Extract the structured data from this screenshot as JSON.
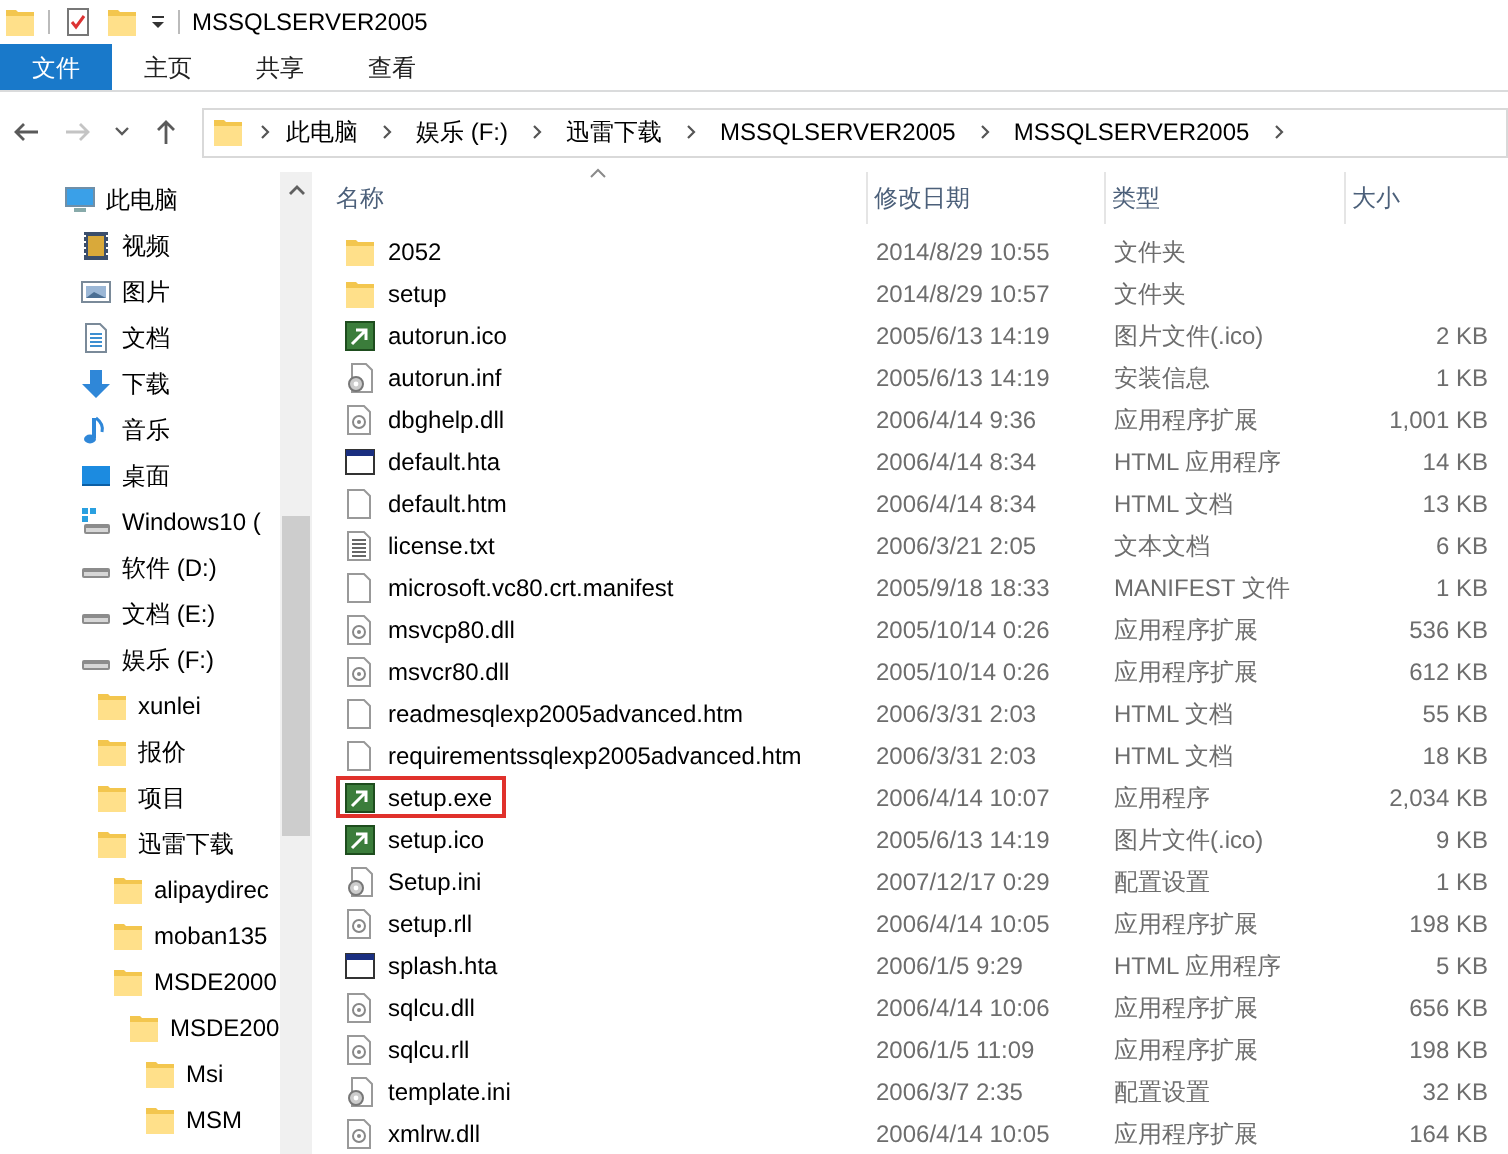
{
  "window": {
    "title": "MSSQLSERVER2005"
  },
  "ribbon_tabs": [
    {
      "label": "文件",
      "selected": true
    },
    {
      "label": "主页",
      "selected": false
    },
    {
      "label": "共享",
      "selected": false
    },
    {
      "label": "查看",
      "selected": false
    }
  ],
  "nav_buttons": [
    {
      "kind": "back",
      "disabled": false
    },
    {
      "kind": "forward",
      "disabled": true
    },
    {
      "kind": "recent",
      "disabled": false
    },
    {
      "kind": "up",
      "disabled": false
    }
  ],
  "breadcrumb": [
    "此电脑",
    "娱乐 (F:)",
    "迅雷下载",
    "MSSQLSERVER2005",
    "MSSQLSERVER2005"
  ],
  "sidebar": {
    "items": [
      {
        "label": "此电脑",
        "kind": "pc",
        "children": [
          {
            "label": "视频",
            "kind": "video"
          },
          {
            "label": "图片",
            "kind": "pictures"
          },
          {
            "label": "文档",
            "kind": "documents"
          },
          {
            "label": "下载",
            "kind": "downloads"
          },
          {
            "label": "音乐",
            "kind": "music"
          },
          {
            "label": "桌面",
            "kind": "desktop"
          },
          {
            "label": "Windows10 (",
            "kind": "os-drive"
          },
          {
            "label": "软件 (D:)",
            "kind": "drive"
          },
          {
            "label": "文档 (E:)",
            "kind": "drive"
          },
          {
            "label": "娱乐 (F:)",
            "kind": "drive",
            "children": [
              {
                "label": "xunlei",
                "kind": "folder"
              },
              {
                "label": "报价",
                "kind": "folder"
              },
              {
                "label": "项目",
                "kind": "folder"
              },
              {
                "label": "迅雷下载",
                "kind": "folder",
                "children": [
                  {
                    "label": "alipaydirec",
                    "kind": "folder"
                  },
                  {
                    "label": "moban135",
                    "kind": "folder"
                  },
                  {
                    "label": "MSDE2000",
                    "kind": "folder",
                    "children": [
                      {
                        "label": "MSDE200",
                        "kind": "folder",
                        "children": [
                          {
                            "label": "Msi",
                            "kind": "folder"
                          },
                          {
                            "label": "MSM",
                            "kind": "folder"
                          }
                        ]
                      }
                    ]
                  }
                ]
              }
            ]
          }
        ]
      }
    ]
  },
  "columns": [
    {
      "label": "名称",
      "sorted": true
    },
    {
      "label": "修改日期",
      "sorted": false
    },
    {
      "label": "类型",
      "sorted": false
    },
    {
      "label": "大小",
      "sorted": false
    }
  ],
  "files": [
    {
      "name": "2052",
      "date": "2014/8/29 10:55",
      "type": "文件夹",
      "kind": "folder",
      "marked": false
    },
    {
      "name": "setup",
      "date": "2014/8/29 10:57",
      "type": "文件夹",
      "kind": "folder",
      "marked": false
    },
    {
      "name": "autorun.ico",
      "date": "2005/6/13 14:19",
      "type": "图片文件(.ico)",
      "size": "2 KB",
      "kind": "image",
      "marked": false
    },
    {
      "name": "autorun.inf",
      "date": "2005/6/13 14:19",
      "type": "安装信息",
      "size": "1 KB",
      "kind": "config",
      "marked": false
    },
    {
      "name": "dbghelp.dll",
      "date": "2006/4/14 9:36",
      "type": "应用程序扩展",
      "size": "1,001 KB",
      "kind": "library",
      "marked": false
    },
    {
      "name": "default.hta",
      "date": "2006/4/14 8:34",
      "type": "HTML 应用程序",
      "size": "14 KB",
      "kind": "window",
      "marked": false
    },
    {
      "name": "default.htm",
      "date": "2006/4/14 8:34",
      "type": "HTML 文档",
      "size": "13 KB",
      "kind": "blank",
      "marked": false
    },
    {
      "name": "license.txt",
      "date": "2006/3/21 2:05",
      "type": "文本文档",
      "size": "6 KB",
      "kind": "text",
      "marked": false
    },
    {
      "name": "microsoft.vc80.crt.manifest",
      "date": "2005/9/18 18:33",
      "type": "MANIFEST 文件",
      "size": "1 KB",
      "kind": "blank",
      "marked": false
    },
    {
      "name": "msvcp80.dll",
      "date": "2005/10/14 0:26",
      "type": "应用程序扩展",
      "size": "536 KB",
      "kind": "library",
      "marked": false
    },
    {
      "name": "msvcr80.dll",
      "date": "2005/10/14 0:26",
      "type": "应用程序扩展",
      "size": "612 KB",
      "kind": "library",
      "marked": false
    },
    {
      "name": "readmesqlexp2005advanced.htm",
      "date": "2006/3/31 2:03",
      "type": "HTML 文档",
      "size": "55 KB",
      "kind": "blank",
      "marked": false
    },
    {
      "name": "requirementssqlexp2005advanced.htm",
      "date": "2006/3/31 2:03",
      "type": "HTML 文档",
      "size": "18 KB",
      "kind": "blank",
      "marked": false
    },
    {
      "name": "setup.exe",
      "date": "2006/4/14 10:07",
      "type": "应用程序",
      "size": "2,034 KB",
      "kind": "image",
      "marked": true
    },
    {
      "name": "setup.ico",
      "date": "2005/6/13 14:19",
      "type": "图片文件(.ico)",
      "size": "9 KB",
      "kind": "image",
      "marked": false
    },
    {
      "name": "Setup.ini",
      "date": "2007/12/17 0:29",
      "type": "配置设置",
      "size": "1 KB",
      "kind": "config",
      "marked": false
    },
    {
      "name": "setup.rll",
      "date": "2006/4/14 10:05",
      "type": "应用程序扩展",
      "size": "198 KB",
      "kind": "library",
      "marked": false
    },
    {
      "name": "splash.hta",
      "date": "2006/1/5 9:29",
      "type": "HTML 应用程序",
      "size": "5 KB",
      "kind": "window",
      "marked": false
    },
    {
      "name": "sqlcu.dll",
      "date": "2006/4/14 10:06",
      "type": "应用程序扩展",
      "size": "656 KB",
      "kind": "library",
      "marked": false
    },
    {
      "name": "sqlcu.rll",
      "date": "2006/1/5 11:09",
      "type": "应用程序扩展",
      "size": "198 KB",
      "kind": "library",
      "marked": false
    },
    {
      "name": "template.ini",
      "date": "2006/3/7 2:35",
      "type": "配置设置",
      "size": "32 KB",
      "kind": "config",
      "marked": false
    },
    {
      "name": "xmlrw.dll",
      "date": "2006/4/14 10:05",
      "type": "应用程序扩展",
      "size": "164 KB",
      "kind": "library",
      "marked": false
    }
  ]
}
